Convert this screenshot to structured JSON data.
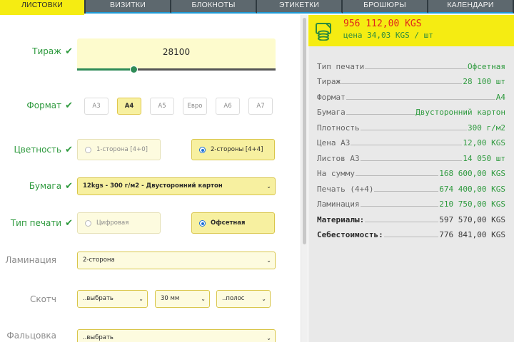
{
  "tabs": [
    {
      "label": "ЛИСТОВКИ",
      "active": true
    },
    {
      "label": "ВИЗИТКИ",
      "active": false
    },
    {
      "label": "БЛОКНОТЫ",
      "active": false
    },
    {
      "label": "ЭТИКЕТКИ",
      "active": false
    },
    {
      "label": "БРОШЮРЫ",
      "active": false
    },
    {
      "label": "КАЛЕНДАРИ",
      "active": false
    }
  ],
  "form": {
    "tirazh": {
      "label": "Тираж",
      "value": "28100",
      "slider_fraction": 0.29
    },
    "format": {
      "label": "Формат",
      "options": [
        "А3",
        "А4",
        "А5",
        "Евро",
        "А6",
        "А7"
      ],
      "selected": "А4"
    },
    "color": {
      "label": "Цветность",
      "options": [
        "1-сторона [4+0]",
        "2-стороны [4+4]"
      ],
      "selected": "2-стороны [4+4]"
    },
    "paper": {
      "label": "Бумага",
      "value": "12kgs - 300 г/м2 - Двусторонний картон"
    },
    "print_type": {
      "label": "Тип печати",
      "options": [
        "Цифровая",
        "Офсетная"
      ],
      "selected": "Офсетная"
    },
    "lamination": {
      "label": "Ламинация",
      "value": "2-сторона"
    },
    "tape": {
      "label": "Скотч",
      "choose": "..выбрать",
      "width": "30 мм",
      "strips": "..полос"
    },
    "folding": {
      "label": "Фальцовка",
      "value": "..выбрать"
    }
  },
  "summary": {
    "total_price": "956 112,00 KGS",
    "unit_price": "цена 34,03 KGS / шт",
    "rows": [
      {
        "key": "Тип печати",
        "value": "Офсетная"
      },
      {
        "key": "Тираж",
        "value": "28 100 шт"
      },
      {
        "key": "Формат",
        "value": "А4"
      },
      {
        "key": "Бумага",
        "value": "Двусторонний картон"
      },
      {
        "key": "Плотность",
        "value": "300 г/м2"
      },
      {
        "key": "Цена А3",
        "value": "12,00 KGS"
      },
      {
        "key": "Листов А3",
        "value": "14 050 шт"
      },
      {
        "key": "На сумму",
        "value": "168 600,00 KGS"
      },
      {
        "key": "Печать (4+4)",
        "value": "674 400,00 KGS"
      },
      {
        "key": "Ламинация",
        "value": "210 750,00 KGS"
      },
      {
        "key": "Материалы:",
        "value": "597 570,00 KGS"
      },
      {
        "key": "Себестоимость:",
        "value": "776 841,00 KGS"
      }
    ]
  },
  "colors": {
    "accent_yellow": "#f5ec12",
    "green": "#2e9a3e",
    "price_red": "#e1261c",
    "tab_grey": "#5d686e"
  },
  "icons": {
    "check": "check-icon",
    "money": "banknote-coins-icon",
    "caret": "chevron-down-icon"
  }
}
